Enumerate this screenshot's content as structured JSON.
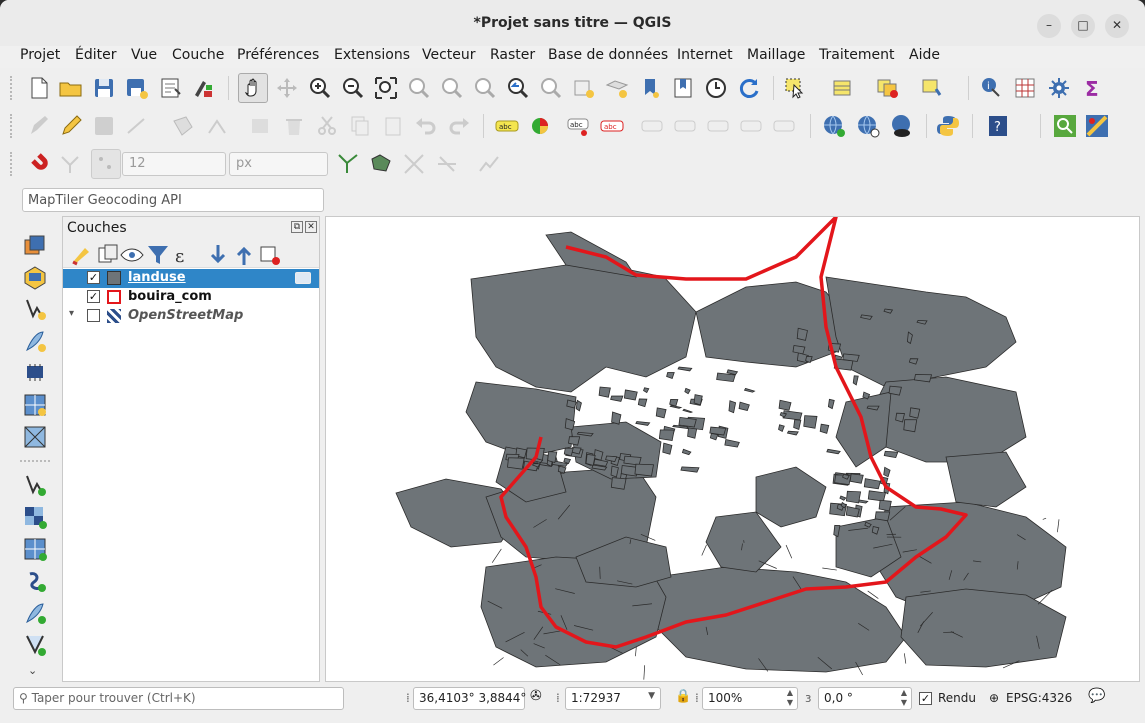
{
  "window": {
    "title": "*Projet sans titre — QGIS",
    "controls": {
      "minimize": "–",
      "maximize": "□",
      "close": "✕"
    }
  },
  "menu": [
    "Projet",
    "Éditer",
    "Vue",
    "Couche",
    "Préférences",
    "Extensions",
    "Vecteur",
    "Raster",
    "Base de données",
    "Internet",
    "Maillage",
    "Traitement",
    "Aide"
  ],
  "snapping": {
    "tolerance": "12",
    "unit": "px"
  },
  "geocoder": {
    "placeholder": "MapTiler Geocoding API"
  },
  "layers_panel": {
    "title": "Couches",
    "controls": {
      "float": "⧉",
      "close": "✕"
    },
    "layers": [
      {
        "name": "landuse",
        "checked": "✓",
        "selected": true
      },
      {
        "name": "bouira_com",
        "checked": "✓",
        "selected": false
      },
      {
        "name": "OpenStreetMap",
        "checked": "",
        "selected": false
      }
    ]
  },
  "statusbar": {
    "search_placeholder": "Taper pour trouver (Ctrl+K)",
    "coordinate": "36,4103° 3,8844°",
    "scale": "1:72937",
    "magnifier": "100%",
    "rotation": "0,0 °",
    "render_label": "Rendu",
    "render_checked": "✓",
    "crs": "EPSG:4326"
  },
  "colors": {
    "polygon_fill": "#6e7478",
    "polygon_stroke": "#2b2b2b",
    "boundary": "#e3161b",
    "selection": "#2f86c8"
  },
  "icons": [
    "new-project-icon",
    "open-project-icon",
    "save-project-icon",
    "save-as-icon",
    "print-layout-icon",
    "style-manager-icon",
    "pan-icon",
    "pan-to-selection-icon",
    "zoom-in-icon",
    "zoom-out-icon",
    "zoom-full-icon",
    "zoom-selection-icon",
    "zoom-layer-icon",
    "zoom-native-icon",
    "zoom-last-icon",
    "zoom-next-icon",
    "new-bookmark-icon",
    "show-bookmarks-icon",
    "temporal-icon",
    "refresh-icon",
    "select-features-icon",
    "attribute-table-icon",
    "deselect-icon",
    "select-by-value-icon",
    "identify-icon",
    "statistics-icon",
    "processing-icon",
    "sum-icon"
  ]
}
